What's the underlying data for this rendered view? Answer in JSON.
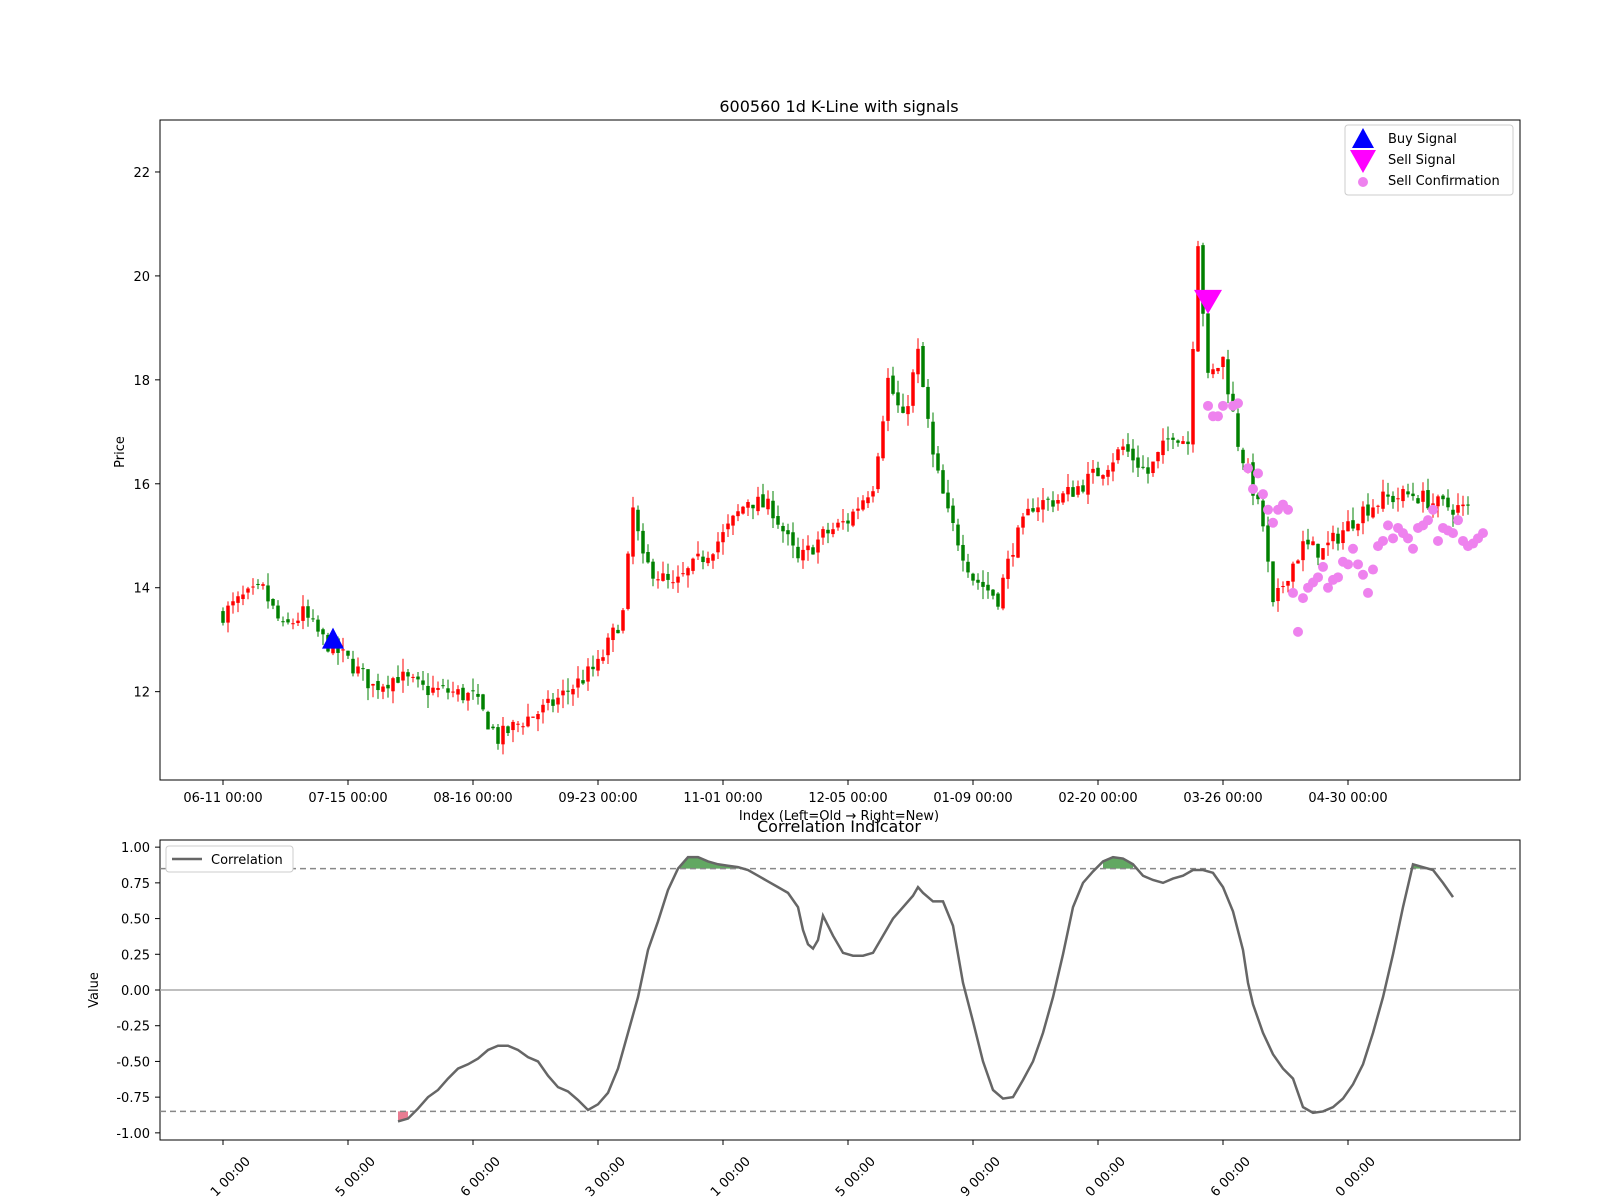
{
  "chart_data": [
    {
      "type": "candlestick",
      "title": "600560 1d K-Line with signals",
      "xlabel": "Index (Left=Old → Right=New)",
      "ylabel": "Price",
      "ylim": [
        10.3,
        23.0
      ],
      "yticks": [
        12,
        14,
        16,
        18,
        20,
        22
      ],
      "xlim": [
        -12,
        262
      ],
      "x_ticks": [
        {
          "index": 0,
          "label": "06-11 00:00"
        },
        {
          "index": 25,
          "label": "07-15 00:00"
        },
        {
          "index": 50,
          "label": "08-16 00:00"
        },
        {
          "index": 75,
          "label": "09-23 00:00"
        },
        {
          "index": 100,
          "label": "11-01 00:00"
        },
        {
          "index": 125,
          "label": "12-05 00:00"
        },
        {
          "index": 150,
          "label": "01-09 00:00"
        },
        {
          "index": 175,
          "label": "02-20 00:00"
        },
        {
          "index": 200,
          "label": "03-26 00:00"
        },
        {
          "index": 225,
          "label": "04-30 00:00"
        }
      ],
      "n_bars": 250,
      "price_path": [
        [
          0,
          13.5
        ],
        [
          4,
          13.8
        ],
        [
          8,
          13.95
        ],
        [
          12,
          13.2
        ],
        [
          16,
          13.5
        ],
        [
          20,
          13.0
        ],
        [
          25,
          12.6
        ],
        [
          30,
          12.1
        ],
        [
          35,
          12.3
        ],
        [
          40,
          12.05
        ],
        [
          45,
          12.0
        ],
        [
          50,
          11.9
        ],
        [
          55,
          11.1
        ],
        [
          60,
          11.45
        ],
        [
          65,
          11.7
        ],
        [
          70,
          12.1
        ],
        [
          75,
          12.5
        ],
        [
          80,
          13.5
        ],
        [
          82,
          15.5
        ],
        [
          84,
          14.5
        ],
        [
          90,
          14.0
        ],
        [
          95,
          14.5
        ],
        [
          100,
          15.0
        ],
        [
          105,
          15.7
        ],
        [
          110,
          15.5
        ],
        [
          115,
          14.5
        ],
        [
          120,
          15.0
        ],
        [
          125,
          15.3
        ],
        [
          130,
          16.0
        ],
        [
          133,
          18.0
        ],
        [
          136,
          17.2
        ],
        [
          139,
          18.5
        ],
        [
          142,
          16.5
        ],
        [
          145,
          15.4
        ],
        [
          150,
          14.2
        ],
        [
          155,
          13.8
        ],
        [
          158,
          14.8
        ],
        [
          162,
          15.6
        ],
        [
          167,
          15.7
        ],
        [
          172,
          16.0
        ],
        [
          176,
          16.3
        ],
        [
          180,
          16.7
        ],
        [
          185,
          16.2
        ],
        [
          190,
          17.0
        ],
        [
          193,
          16.8
        ],
        [
          195,
          20.7
        ],
        [
          197,
          18.0
        ],
        [
          200,
          18.4
        ],
        [
          203,
          16.8
        ],
        [
          206,
          15.9
        ],
        [
          208,
          15.2
        ],
        [
          210,
          13.6
        ],
        [
          213,
          14.3
        ],
        [
          216,
          14.8
        ],
        [
          220,
          14.7
        ],
        [
          225,
          15.2
        ],
        [
          228,
          15.5
        ],
        [
          232,
          15.7
        ],
        [
          238,
          15.8
        ],
        [
          243,
          15.6
        ],
        [
          249,
          15.5
        ]
      ],
      "buy_signals": [
        {
          "index": 22,
          "price": 13.0
        }
      ],
      "sell_signals": [
        {
          "index": 197,
          "price": 19.5
        }
      ],
      "sell_confirmations": [
        [
          197,
          17.5
        ],
        [
          198,
          17.3
        ],
        [
          199,
          17.3
        ],
        [
          200,
          17.5
        ],
        [
          202,
          17.5
        ],
        [
          203,
          17.55
        ],
        [
          205,
          16.3
        ],
        [
          206,
          15.9
        ],
        [
          207,
          16.2
        ],
        [
          208,
          15.8
        ],
        [
          209,
          15.5
        ],
        [
          210,
          15.25
        ],
        [
          211,
          15.5
        ],
        [
          212,
          15.6
        ],
        [
          213,
          15.5
        ],
        [
          214,
          13.9
        ],
        [
          215,
          13.15
        ],
        [
          216,
          13.8
        ],
        [
          217,
          14.0
        ],
        [
          218,
          14.1
        ],
        [
          219,
          14.2
        ],
        [
          220,
          14.4
        ],
        [
          221,
          14.0
        ],
        [
          222,
          14.15
        ],
        [
          223,
          14.2
        ],
        [
          224,
          14.5
        ],
        [
          225,
          14.45
        ],
        [
          226,
          14.75
        ],
        [
          227,
          14.45
        ],
        [
          228,
          14.25
        ],
        [
          229,
          13.9
        ],
        [
          230,
          14.35
        ],
        [
          231,
          14.8
        ],
        [
          232,
          14.9
        ],
        [
          233,
          15.2
        ],
        [
          234,
          14.95
        ],
        [
          235,
          15.15
        ],
        [
          236,
          15.05
        ],
        [
          237,
          14.95
        ],
        [
          238,
          14.75
        ],
        [
          239,
          15.15
        ],
        [
          240,
          15.2
        ],
        [
          241,
          15.3
        ],
        [
          242,
          15.5
        ],
        [
          243,
          14.9
        ],
        [
          244,
          15.15
        ],
        [
          245,
          15.1
        ],
        [
          246,
          15.05
        ],
        [
          247,
          15.3
        ],
        [
          248,
          14.9
        ],
        [
          249,
          14.8
        ],
        [
          250,
          14.85
        ],
        [
          251,
          14.95
        ],
        [
          252,
          15.05
        ]
      ],
      "legend": {
        "position": "top-right",
        "entries": [
          {
            "label": "Buy Signal",
            "color": "#0000ff",
            "marker": "triangle-up"
          },
          {
            "label": "Sell Signal",
            "color": "#ff00ff",
            "marker": "triangle-down"
          },
          {
            "label": "Sell Confirmation",
            "color": "#ee82ee",
            "marker": "circle"
          }
        ]
      },
      "colors": {
        "up": "#ff0000",
        "down": "#008000"
      }
    },
    {
      "type": "line",
      "title": "Correlation Indicator",
      "xlabel": "",
      "ylabel": "Value",
      "ylim": [
        -1.05,
        1.05
      ],
      "yticks": [
        -1.0,
        -0.75,
        -0.5,
        -0.25,
        0.0,
        0.25,
        0.5,
        0.75,
        1.0
      ],
      "threshold_upper": 0.85,
      "threshold_lower": -0.85,
      "x_tick_labels_visible": [
        "1 00:00",
        "5 00:00",
        "6 00:00",
        "3 00:00",
        "1 00:00",
        "5 00:00",
        "9 00:00",
        "0 00:00",
        "6 00:00",
        "0 00:00"
      ],
      "series": [
        {
          "name": "Correlation",
          "color": "#666666",
          "points": [
            [
              35,
              -0.92
            ],
            [
              37,
              -0.9
            ],
            [
              39,
              -0.83
            ],
            [
              41,
              -0.75
            ],
            [
              43,
              -0.7
            ],
            [
              45,
              -0.62
            ],
            [
              47,
              -0.55
            ],
            [
              49,
              -0.52
            ],
            [
              51,
              -0.48
            ],
            [
              53,
              -0.42
            ],
            [
              55,
              -0.39
            ],
            [
              57,
              -0.39
            ],
            [
              59,
              -0.42
            ],
            [
              61,
              -0.47
            ],
            [
              63,
              -0.5
            ],
            [
              65,
              -0.6
            ],
            [
              67,
              -0.68
            ],
            [
              69,
              -0.71
            ],
            [
              71,
              -0.77
            ],
            [
              73,
              -0.84
            ],
            [
              75,
              -0.8
            ],
            [
              77,
              -0.72
            ],
            [
              79,
              -0.55
            ],
            [
              81,
              -0.3
            ],
            [
              83,
              -0.05
            ],
            [
              85,
              0.28
            ],
            [
              87,
              0.48
            ],
            [
              89,
              0.7
            ],
            [
              91,
              0.85
            ],
            [
              93,
              0.93
            ],
            [
              95,
              0.93
            ],
            [
              97,
              0.9
            ],
            [
              99,
              0.88
            ],
            [
              101,
              0.87
            ],
            [
              103,
              0.86
            ],
            [
              105,
              0.84
            ],
            [
              107,
              0.8
            ],
            [
              109,
              0.76
            ],
            [
              111,
              0.72
            ],
            [
              113,
              0.68
            ],
            [
              115,
              0.58
            ],
            [
              116,
              0.42
            ],
            [
              117,
              0.32
            ],
            [
              118,
              0.29
            ],
            [
              119,
              0.35
            ],
            [
              120,
              0.52
            ],
            [
              122,
              0.38
            ],
            [
              124,
              0.26
            ],
            [
              126,
              0.24
            ],
            [
              128,
              0.24
            ],
            [
              130,
              0.26
            ],
            [
              132,
              0.38
            ],
            [
              134,
              0.5
            ],
            [
              136,
              0.58
            ],
            [
              138,
              0.66
            ],
            [
              139,
              0.72
            ],
            [
              140,
              0.68
            ],
            [
              142,
              0.62
            ],
            [
              144,
              0.62
            ],
            [
              146,
              0.45
            ],
            [
              148,
              0.05
            ],
            [
              150,
              -0.22
            ],
            [
              152,
              -0.5
            ],
            [
              154,
              -0.7
            ],
            [
              156,
              -0.76
            ],
            [
              158,
              -0.75
            ],
            [
              160,
              -0.63
            ],
            [
              162,
              -0.5
            ],
            [
              164,
              -0.3
            ],
            [
              166,
              -0.05
            ],
            [
              168,
              0.25
            ],
            [
              170,
              0.58
            ],
            [
              172,
              0.75
            ],
            [
              174,
              0.83
            ],
            [
              176,
              0.9
            ],
            [
              178,
              0.93
            ],
            [
              180,
              0.92
            ],
            [
              182,
              0.88
            ],
            [
              184,
              0.8
            ],
            [
              186,
              0.77
            ],
            [
              188,
              0.75
            ],
            [
              190,
              0.78
            ],
            [
              192,
              0.8
            ],
            [
              194,
              0.84
            ],
            [
              196,
              0.84
            ],
            [
              198,
              0.82
            ],
            [
              200,
              0.72
            ],
            [
              202,
              0.55
            ],
            [
              204,
              0.28
            ],
            [
              205,
              0.05
            ],
            [
              206,
              -0.1
            ],
            [
              208,
              -0.3
            ],
            [
              210,
              -0.45
            ],
            [
              212,
              -0.55
            ],
            [
              214,
              -0.62
            ],
            [
              216,
              -0.82
            ],
            [
              218,
              -0.86
            ],
            [
              220,
              -0.85
            ],
            [
              222,
              -0.82
            ],
            [
              224,
              -0.76
            ],
            [
              226,
              -0.66
            ],
            [
              228,
              -0.52
            ],
            [
              230,
              -0.3
            ],
            [
              232,
              -0.05
            ],
            [
              234,
              0.25
            ],
            [
              236,
              0.58
            ],
            [
              238,
              0.88
            ],
            [
              240,
              0.86
            ],
            [
              242,
              0.84
            ],
            [
              244,
              0.75
            ],
            [
              246,
              0.65
            ]
          ]
        }
      ],
      "legend": {
        "position": "top-left",
        "entries": [
          {
            "label": "Correlation",
            "color": "#666666"
          }
        ]
      },
      "fill_colors": {
        "above": "#2e8b2e",
        "below": "#e0506e"
      }
    }
  ]
}
